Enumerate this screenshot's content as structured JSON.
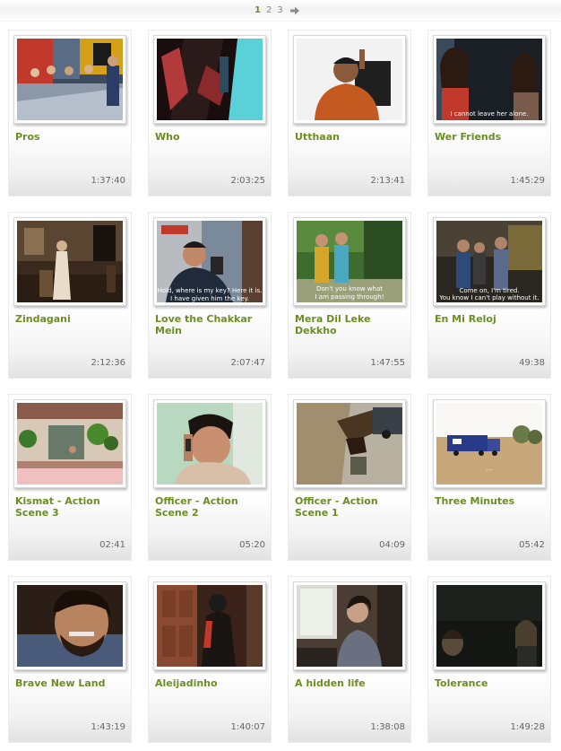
{
  "pagination": {
    "pages": [
      "1",
      "2",
      "3"
    ],
    "current": "1",
    "next_icon": "arrow-right-icon"
  },
  "videos": [
    {
      "title": "Pros",
      "duration": "1:37:40"
    },
    {
      "title": "Who",
      "duration": "2:03:25"
    },
    {
      "title": "Utthaan",
      "duration": "2:13:41"
    },
    {
      "title": "Wer Friends",
      "duration": "1:45:29",
      "caption": "I cannot leave her alone."
    },
    {
      "title": "Zindagani",
      "duration": "2:12:36"
    },
    {
      "title": "Love the Chakkar Mein",
      "duration": "2:07:47",
      "caption": "Hold, where is my key? Here it is. I have given him the key."
    },
    {
      "title": "Mera Dil Leke Dekkho",
      "duration": "1:47:55",
      "caption": "Don't you know what I am passing through!"
    },
    {
      "title": "En Mi Reloj",
      "duration": "49:38",
      "caption": "Come on, I'm tired. You know I can't play without it."
    },
    {
      "title": "Kismat - Action Scene 3",
      "duration": "02:41"
    },
    {
      "title": "Officer - Action Scene 2",
      "duration": "05:20"
    },
    {
      "title": "Officer - Action Scene 1",
      "duration": "04:09"
    },
    {
      "title": "Three Minutes",
      "duration": "05:42"
    },
    {
      "title": "Brave New Land",
      "duration": "1:43:19"
    },
    {
      "title": "Aleijadinho",
      "duration": "1:40:07"
    },
    {
      "title": "A hidden life",
      "duration": "1:38:08"
    },
    {
      "title": "Tolerance",
      "duration": "1:49:28"
    }
  ]
}
